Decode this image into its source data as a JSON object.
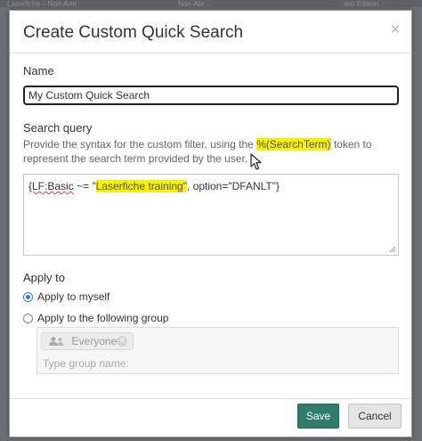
{
  "background": {
    "fragments": [
      "Laserfiche – Non-Arm",
      "Non-Abr...",
      "...ard Edition..."
    ]
  },
  "dialog": {
    "title": "Create Custom Quick Search",
    "close_glyph": "×"
  },
  "name_section": {
    "label": "Name",
    "value": "My Custom Quick Search"
  },
  "query_section": {
    "label": "Search query",
    "help_before": "Provide the syntax for the custom filter, using the ",
    "help_token": "%(SearchTerm)",
    "help_after": " token to represent the search term provided by the user.",
    "query_part1": "{LF:Basic",
    "query_part2": " ~= \"",
    "query_part3": "Laserfiche training\"",
    "query_part4": ", option=\"DFANLT\"}"
  },
  "apply_section": {
    "label": "Apply to",
    "option_self": "Apply to myself",
    "option_group": "Apply to the following group",
    "selected": "self",
    "chip_label": "Everyone",
    "chip_remove_glyph": "×",
    "group_placeholder": "Type group name:"
  },
  "footer": {
    "save_label": "Save",
    "cancel_label": "Cancel"
  },
  "colors": {
    "accent": "#2e7d6b",
    "highlight": "#f6f100",
    "radio": "#3b7bd6"
  },
  "icons": {
    "close": "close-icon",
    "group": "users-icon",
    "remove": "remove-chip-icon",
    "pointer": "mouse-cursor-icon",
    "resize": "resize-handle-icon"
  }
}
